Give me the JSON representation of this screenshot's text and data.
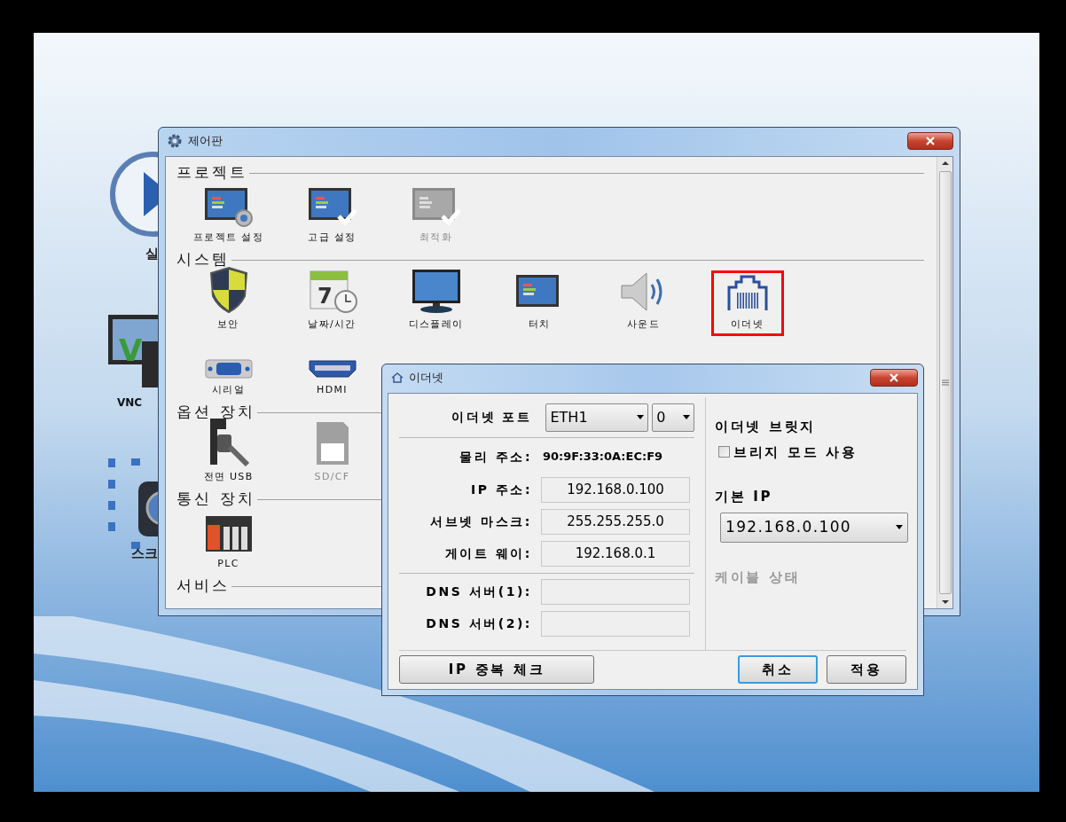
{
  "desktop_icons": [
    {
      "label": "실",
      "kind": "play"
    },
    {
      "label": "VNC",
      "kind": "vnc",
      "glyph": "V"
    },
    {
      "label": "스크",
      "kind": "camera"
    }
  ],
  "control_panel": {
    "title": "제어판",
    "sections": [
      {
        "title": "프로젝트",
        "items": [
          {
            "label": "프로젝트 설정",
            "kind": "settings",
            "disabled": false,
            "selected": false
          },
          {
            "label": "고급 설정",
            "kind": "check",
            "disabled": false,
            "selected": false
          },
          {
            "label": "최적화",
            "kind": "check",
            "disabled": true,
            "selected": false
          }
        ]
      },
      {
        "title": "시스템",
        "items": [
          {
            "label": "보안",
            "kind": "shield",
            "disabled": false,
            "selected": false
          },
          {
            "label": "날짜/시간",
            "kind": "calendar",
            "day": "7",
            "disabled": false,
            "selected": false
          },
          {
            "label": "디스플레이",
            "kind": "monitor",
            "disabled": false,
            "selected": false
          },
          {
            "label": "터치",
            "kind": "touch",
            "disabled": false,
            "selected": false
          },
          {
            "label": "사운드",
            "kind": "speaker",
            "disabled": false,
            "selected": false
          },
          {
            "label": "이더넷",
            "kind": "ethernet",
            "disabled": false,
            "selected": true
          },
          {
            "label": "시리얼",
            "kind": "serial",
            "disabled": false,
            "selected": false
          },
          {
            "label": "HDMI",
            "kind": "hdmi",
            "disabled": false,
            "selected": false
          }
        ]
      },
      {
        "title": "옵션 장치",
        "items": [
          {
            "label": "전면 USB",
            "kind": "usb",
            "disabled": false,
            "selected": false
          },
          {
            "label": "SD/CF",
            "kind": "sdcard",
            "disabled": true,
            "selected": false
          }
        ]
      },
      {
        "title": "통신 장치",
        "items": [
          {
            "label": "PLC",
            "kind": "plc",
            "disabled": false,
            "selected": false
          }
        ]
      },
      {
        "title": "서비스"
      }
    ]
  },
  "ethernet_dialog": {
    "title": "이더넷",
    "port": {
      "label": "이더넷 포트",
      "value": "ETH1",
      "channel": "0"
    },
    "mac": {
      "label": "물리 주소:",
      "value": "90:9F:33:0A:EC:F9"
    },
    "fields": [
      {
        "label": "IP 주소:",
        "value": "192.168.0.100"
      },
      {
        "label": "서브넷 마스크:",
        "value": "255.255.255.0"
      },
      {
        "label": "게이트 웨이:",
        "value": "192.168.0.1"
      }
    ],
    "dns": [
      {
        "label": "DNS 서버(1):"
      },
      {
        "label": "DNS 서버(2):"
      }
    ],
    "bridge": {
      "title": "이더넷 브릿지",
      "checkbox": {
        "label": "브리지 모드 사용",
        "checked": false
      }
    },
    "default_ip": {
      "label": "기본 IP",
      "value": "192.168.0.100"
    },
    "cable_status": {
      "label": "케이블 상태",
      "disabled": true
    },
    "buttons": [
      {
        "label": "IP 중복 체크",
        "default": false
      },
      {
        "label": "취소",
        "default": true
      },
      {
        "label": "적용",
        "default": false
      }
    ]
  }
}
